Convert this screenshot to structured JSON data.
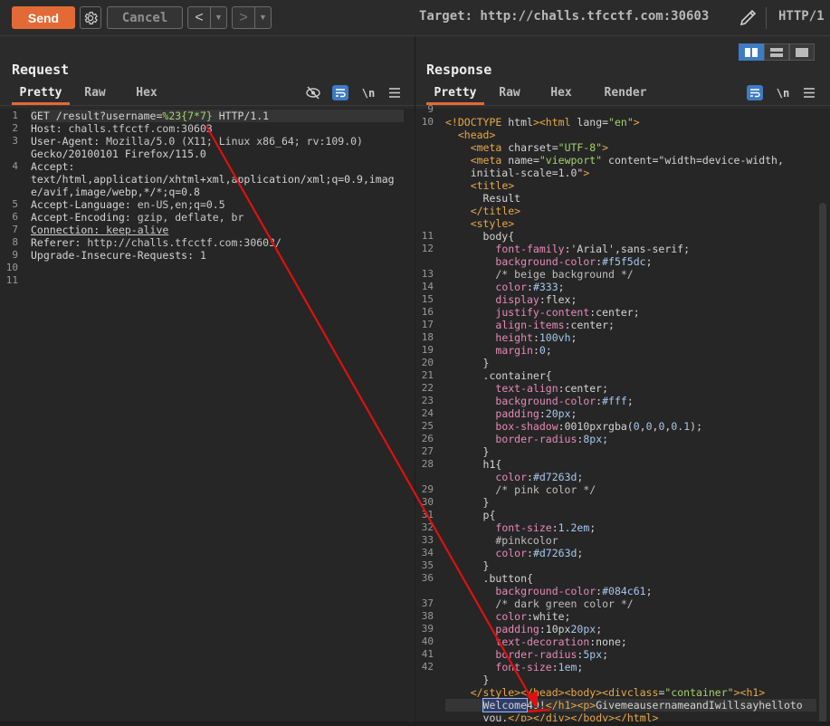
{
  "toolbar": {
    "send_label": "Send",
    "cancel_label": "Cancel",
    "back_glyph": "<",
    "forward_glyph": ">",
    "dropdown_glyph": "▼",
    "target_text": "Target: http://challs.tfcctf.com:30603",
    "protocol_text": "HTTP/1",
    "icons": [
      "gear-icon",
      "pencil-icon"
    ]
  },
  "request": {
    "title": "Request",
    "tabs": [
      "Pretty",
      "Raw",
      "Hex"
    ],
    "active_tab": "Pretty",
    "newline_label": "\\n",
    "lines": [
      {
        "n": "1",
        "text": "GET /result?username=%23{7*7} HTTP/1.1"
      },
      {
        "n": "2",
        "text": "Host: challs.tfcctf.com:30603"
      },
      {
        "n": "3",
        "text": "User-Agent: Mozilla/5.0 (X11; Linux x86_64; rv:109.0)"
      },
      {
        "n": "",
        "text": "Gecko/20100101 Firefox/115.0"
      },
      {
        "n": "4",
        "text": "Accept:"
      },
      {
        "n": "",
        "text": "text/html,application/xhtml+xml,application/xml;q=0.9,imag"
      },
      {
        "n": "",
        "text": "e/avif,image/webp,*/*;q=0.8"
      },
      {
        "n": "5",
        "text": "Accept-Language: en-US,en;q=0.5"
      },
      {
        "n": "6",
        "text": "Accept-Encoding: gzip, deflate, br"
      },
      {
        "n": "7",
        "text": "Connection: keep-alive"
      },
      {
        "n": "8",
        "text": "Referer: http://challs.tfcctf.com:30603/"
      },
      {
        "n": "9",
        "text": "Upgrade-Insecure-Requests: 1"
      },
      {
        "n": "10",
        "text": ""
      },
      {
        "n": "11",
        "text": ""
      }
    ]
  },
  "response": {
    "title": "Response",
    "tabs": [
      "Pretty",
      "Raw",
      "Hex",
      "Render"
    ],
    "active_tab": "Pretty",
    "newline_label": "\\n",
    "gutter": [
      "9",
      "10",
      "",
      "",
      "",
      "",
      "",
      "",
      "",
      "",
      "11",
      "12",
      "",
      "13",
      "14",
      "15",
      "16",
      "17",
      "18",
      "19",
      "20",
      "21",
      "22",
      "23",
      "24",
      "25",
      "26",
      "27",
      "28",
      "",
      "29",
      "30",
      "31",
      "32",
      "33",
      "34",
      "35",
      "36",
      "",
      "37",
      "38",
      "39",
      "40",
      "41",
      "42",
      "",
      ""
    ],
    "lines": [
      "",
      "<!DOCTYPE html><html lang=\"en\">",
      "  <head>",
      "    <meta charset=\"UTF-8\">",
      "    <meta name=\"viewport\" content=\"width=device-width,",
      "    initial-scale=1.0\">",
      "    <title>",
      "      Result",
      "    </title>",
      "    <style>",
      "      body{",
      "        font-family:'Arial',sans-serif;",
      "        background-color:#f5f5dc;",
      "        /* beige background */",
      "        color:#333;",
      "        display:flex;",
      "        justify-content:center;",
      "        align-items:center;",
      "        height:100vh;",
      "        margin:0;",
      "      }",
      "      .container{",
      "        text-align:center;",
      "        background-color:#fff;",
      "        padding:20px;",
      "        box-shadow:0010pxrgba(0,0,0,0.1);",
      "        border-radius:8px;",
      "      }",
      "      h1{",
      "        color:#d7263d;",
      "        /* pink color */",
      "      }",
      "      p{",
      "        font-size:1.2em;",
      "        #pinkcolor",
      "        color:#d7263d;",
      "      }",
      "      .button{",
      "        background-color:#084c61;",
      "        /* dark green color */",
      "        color:white;",
      "        padding:10px20px;",
      "        text-decoration:none;",
      "        border-radius:5px;",
      "        font-size:1em;",
      "      }",
      "    </style></head><body><divclass=\"container\"><h1>",
      "      Welcome49!</h1><p>GivemeausernameandIwillsayhelloto",
      "      you.</p></div></body></html>"
    ]
  },
  "colors": {
    "accent": "#e36a36",
    "selected": "#3e7bc4",
    "arrow": "#e01010"
  }
}
